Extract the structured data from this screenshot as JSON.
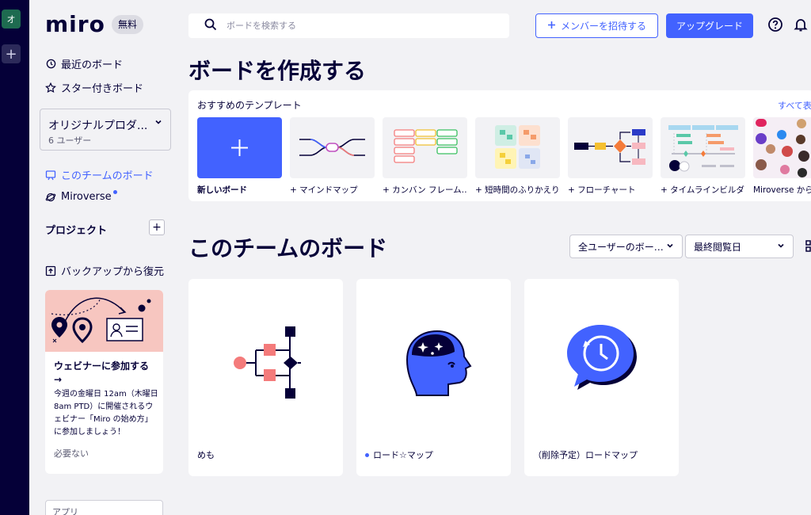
{
  "rail": {
    "org_initial": "オ",
    "add_label": "+"
  },
  "sidebar": {
    "logo": "miro",
    "plan_badge": "無料",
    "recent": "最近のボード",
    "starred": "スター付きボード",
    "team": {
      "name": "オリジナルプロダ...",
      "users": "6 ユーザー"
    },
    "team_boards": "このチームのボード",
    "miroverse": "Miroverse",
    "projects_title": "プロジェクト",
    "projects_add": "+",
    "restore": "バックアップから復元",
    "webinar": {
      "title": "ウェビナーに参加する →",
      "body": "今週の金曜日 12am（木曜日 8am PTD）に開催されるウェビナー「Miro の始め方」に参加しましょう！",
      "dismiss": "必要ない"
    },
    "apps": "アプリ"
  },
  "header": {
    "search_placeholder": "ボードを検索する",
    "invite": "メンバーを招待する",
    "upgrade": "アップグレード"
  },
  "create_title": "ボードを作成する",
  "templates": {
    "heading": "おすすめのテンプレート",
    "see_all": "すべて表示",
    "items": [
      {
        "label": "新しいボード"
      },
      {
        "label": "+ マインドマップ"
      },
      {
        "label": "+ カンバン フレーム…"
      },
      {
        "label": "+ 短時間のふりかえり"
      },
      {
        "label": "+ フローチャート"
      },
      {
        "label": "+ タイムラインビルダ…"
      },
      {
        "label": "Miroverse から"
      }
    ]
  },
  "boards_section": {
    "title": "このチームのボード",
    "owner_filter": "全ユーザーのボー…",
    "sort_filter": "最終閲覧日",
    "boards": [
      {
        "name": "めも"
      },
      {
        "name": "ロード☆マップ"
      },
      {
        "name": "（削除予定）ロードマップ"
      }
    ]
  },
  "colors": {
    "accent": "#4262ff",
    "navy": "#050038",
    "background": "#f2f2f5",
    "pink": "#f7c6c0",
    "coral": "#f47b7b"
  }
}
